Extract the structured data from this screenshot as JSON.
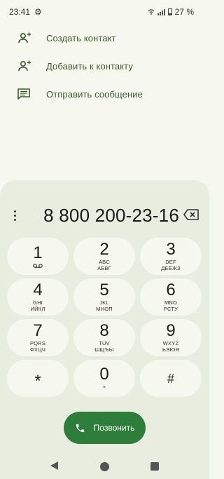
{
  "status_bar": {
    "time": "23:41",
    "battery_percent": "27 %",
    "icons": [
      "settings-gear-icon",
      "wifi-calling-icon",
      "signal-icon",
      "battery-icon"
    ]
  },
  "actions": [
    {
      "label": "Создать контакт",
      "icon": "person-add-icon"
    },
    {
      "label": "Добавить к контакту",
      "icon": "person-add-icon"
    },
    {
      "label": "Отправить сообщение",
      "icon": "message-icon"
    }
  ],
  "dialer": {
    "number": "8 800 200-23-16",
    "keys": [
      {
        "digit": "1",
        "sub": ""
      },
      {
        "digit": "2",
        "sub": "ABC",
        "sub2": "АБВГ"
      },
      {
        "digit": "3",
        "sub": "DEF",
        "sub2": "ДЕЁЖЗ"
      },
      {
        "digit": "4",
        "sub": "GHI",
        "sub2": "ИЙКЛ"
      },
      {
        "digit": "5",
        "sub": "JKL",
        "sub2": "МНОП"
      },
      {
        "digit": "6",
        "sub": "MNO",
        "sub2": "РСТУ"
      },
      {
        "digit": "7",
        "sub": "PQRS",
        "sub2": "ФХЦЧ"
      },
      {
        "digit": "8",
        "sub": "TUV",
        "sub2": "ШЩЪЫ"
      },
      {
        "digit": "9",
        "sub": "WXYZ",
        "sub2": "ЬЭЮЯ"
      },
      {
        "digit": "*",
        "sub": ""
      },
      {
        "digit": "0",
        "sub": "+"
      },
      {
        "digit": "#",
        "sub": ""
      }
    ],
    "call_label": "Позвонить"
  },
  "colors": {
    "accent": "#2e7d3a",
    "background": "#f6f8f0",
    "panel": "#e8ede0",
    "action_text": "#3c5a2e"
  }
}
